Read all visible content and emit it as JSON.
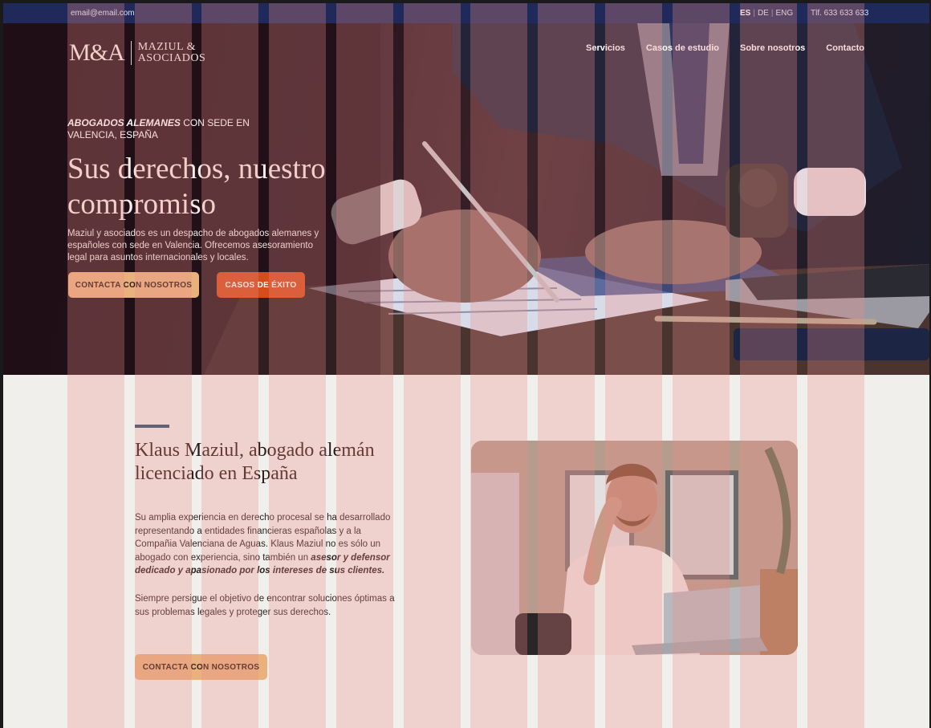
{
  "topbar": {
    "email": "email@email.com",
    "languages": [
      {
        "label": "ES",
        "active": true
      },
      {
        "label": "DE",
        "active": false
      },
      {
        "label": "ENG",
        "active": false
      }
    ],
    "language_separator": "|",
    "phone": "Tlf. 633 633 633"
  },
  "logo": {
    "mark": "M&A",
    "name_line1": "MAZIUL &",
    "name_line2": "ASOCIADOS"
  },
  "nav": {
    "items": [
      "Servicios",
      "Casos de estudio",
      "Sobre nosotros",
      "Contacto"
    ]
  },
  "hero": {
    "eyebrow_emphasis": "ABOGADOS ALEMANES",
    "eyebrow_rest": " CON SEDE EN VALENCIA, ESPAÑA",
    "title": "Sus derechos, nuestro compromiso",
    "description": "Maziul y asociados es un despacho de abogados alemanes y españoles con sede en Valencia. Ofrecemos asesoramiento legal para asuntos internacionales y locales.",
    "contact_button": "CONTACTA CON NOSOTROS",
    "cases_button": "CASOS DE ÉXITO"
  },
  "about": {
    "title": "Klaus Maziul, abogado alemán licenciado en España",
    "paragraph1_plain": "Su amplia experiencia en derecho procesal se ha desarrollado representando a entidades financieras españolas y a la Compañia Valenciana de Aguas. Klaus Maziul no es sólo un abogado con experiencia, sino también un ",
    "paragraph1_emphasis": "asesor y defensor dedicado y apasionado por los intereses de sus clientes.",
    "paragraph2": "Siempre persigue el objetivo de encontrar soluciones óptimas a sus problemas legales y proteger sus derechos.",
    "contact_button": "CONTACTA CON NOSOTROS"
  },
  "colors": {
    "topbar": "#1f2a5a",
    "accent_orange": "#d64d1c",
    "accent_peach": "#e9b27d",
    "accent_bar": "#27516f",
    "background": "#f1efeb"
  }
}
